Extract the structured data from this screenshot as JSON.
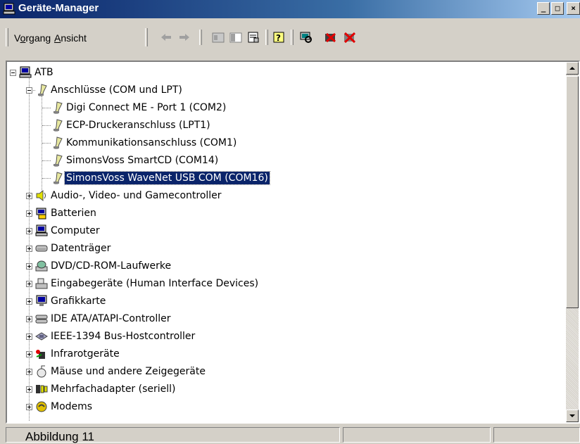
{
  "window": {
    "title": "Geräte-Manager",
    "minimize_glyph": "_",
    "maximize_glyph": "□",
    "close_glyph": "×"
  },
  "menu": {
    "items": [
      {
        "label": "Vorgang",
        "accesskey": "o"
      },
      {
        "label": "Ansicht",
        "accesskey": "A"
      }
    ]
  },
  "toolbar": {
    "buttons": [
      "back-icon",
      "forward-icon",
      "up-icon",
      "console-tree-icon",
      "properties-icon",
      "help-icon",
      "scan-hardware-icon",
      "uninstall-icon",
      "disable-device-icon"
    ]
  },
  "tree": {
    "root": "ATB",
    "ports": {
      "label": "Anschlüsse (COM und LPT)",
      "children": [
        "Digi Connect ME - Port 1 (COM2)",
        "ECP-Druckeranschluss (LPT1)",
        "Kommunikationsanschluss (COM1)",
        "SimonsVoss SmartCD (COM14)",
        "SimonsVoss WaveNet USB COM (COM16)"
      ],
      "selected_index": 4
    },
    "categories": [
      {
        "label": "Audio-, Video- und Gamecontroller",
        "icon": "audio-icon"
      },
      {
        "label": "Batterien",
        "icon": "battery-icon"
      },
      {
        "label": "Computer",
        "icon": "computer-icon"
      },
      {
        "label": "Datenträger",
        "icon": "disk-drive-icon"
      },
      {
        "label": "DVD/CD-ROM-Laufwerke",
        "icon": "cdrom-icon"
      },
      {
        "label": "Eingabegeräte (Human Interface Devices)",
        "icon": "hid-icon"
      },
      {
        "label": "Grafikkarte",
        "icon": "display-adapter-icon"
      },
      {
        "label": "IDE ATA/ATAPI-Controller",
        "icon": "ide-controller-icon"
      },
      {
        "label": "IEEE-1394 Bus-Hostcontroller",
        "icon": "firewire-icon"
      },
      {
        "label": "Infrarotgeräte",
        "icon": "infrared-icon"
      },
      {
        "label": "Mäuse und andere Zeigegeräte",
        "icon": "mouse-icon"
      },
      {
        "label": "Mehrfachadapter (seriell)",
        "icon": "multiport-icon"
      },
      {
        "label": "Modems",
        "icon": "modem-icon"
      }
    ]
  },
  "status": {
    "caption": "Abbildung 11"
  },
  "colors": {
    "title_start": "#0a246a",
    "title_end": "#a6caf0",
    "selection": "#0a246a",
    "face": "#d4d0c8"
  }
}
